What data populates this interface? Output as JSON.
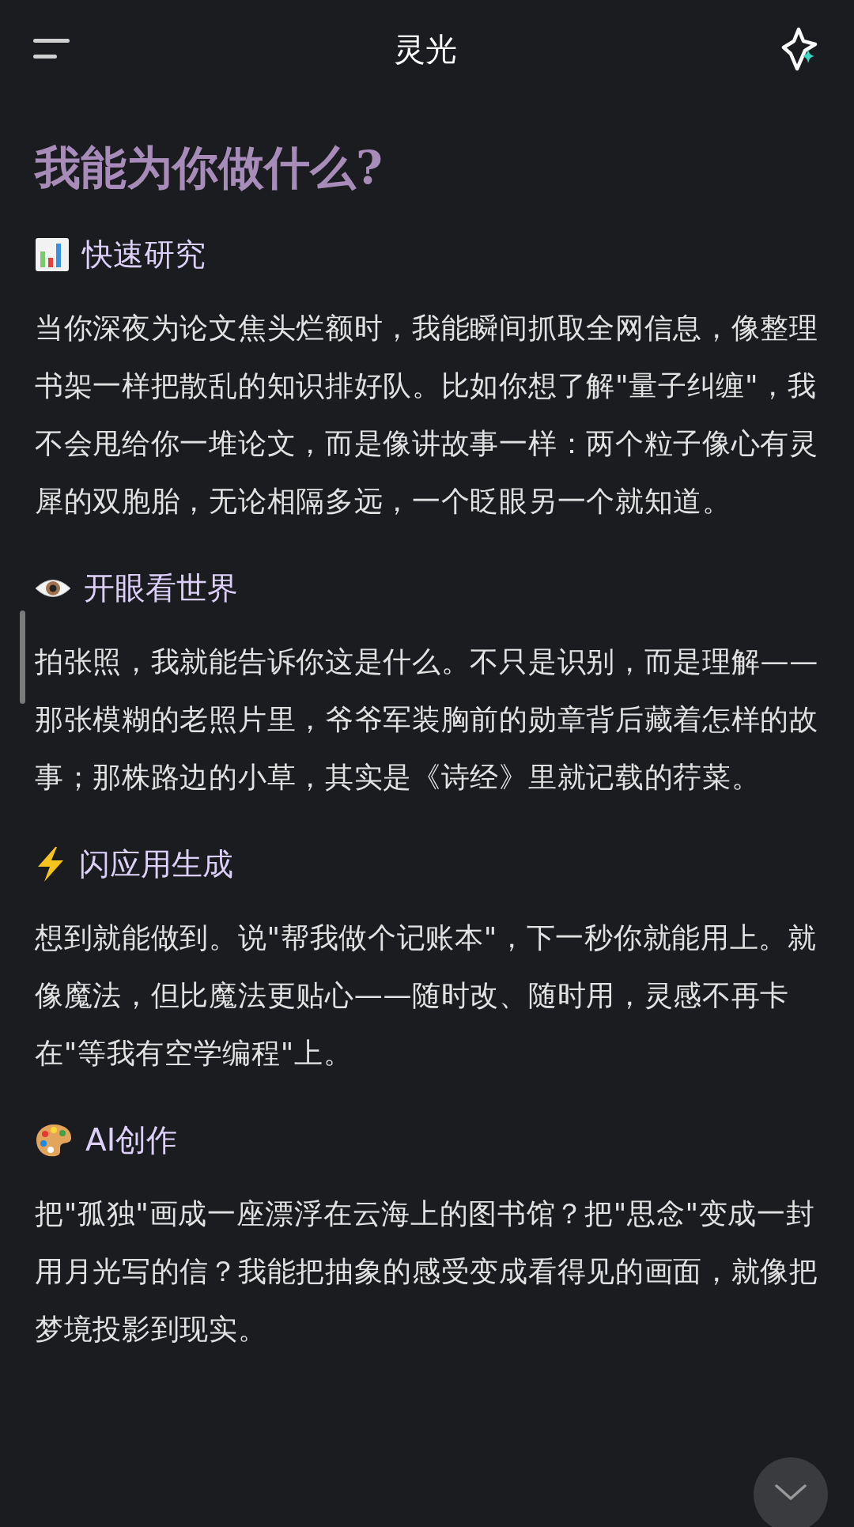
{
  "header": {
    "title": "灵光"
  },
  "heading": "我能为你做什么?",
  "sections": [
    {
      "kind": "chart",
      "title": "快速研究",
      "body": "当你深夜为论文焦头烂额时，我能瞬间抓取全网信息，像整理书架一样把散乱的知识排好队。比如你想了解\"量子纠缠\"，我不会甩给你一堆论文，而是像讲故事一样：两个粒子像心有灵犀的双胞胎，无论相隔多远，一个眨眼另一个就知道。"
    },
    {
      "kind": "eye",
      "title": "开眼看世界",
      "body": "拍张照，我就能告诉你这是什么。不只是识别，而是理解——那张模糊的老照片里，爷爷军装胸前的勋章背后藏着怎样的故事；那株路边的小草，其实是《诗经》里就记载的荇菜。"
    },
    {
      "kind": "bolt",
      "title": "闪应用生成",
      "body": "想到就能做到。说\"帮我做个记账本\"，下一秒你就能用上。就像魔法，但比魔法更贴心——随时改、随时用，灵感不再卡在\"等我有空学编程\"上。"
    },
    {
      "kind": "palette",
      "title": "AI创作",
      "body": "把\"孤独\"画成一座漂浮在云海上的图书馆？把\"思念\"变成一封用月光写的信？我能把抽象的感受变成看得见的画面，就像把梦境投影到现实。"
    }
  ]
}
